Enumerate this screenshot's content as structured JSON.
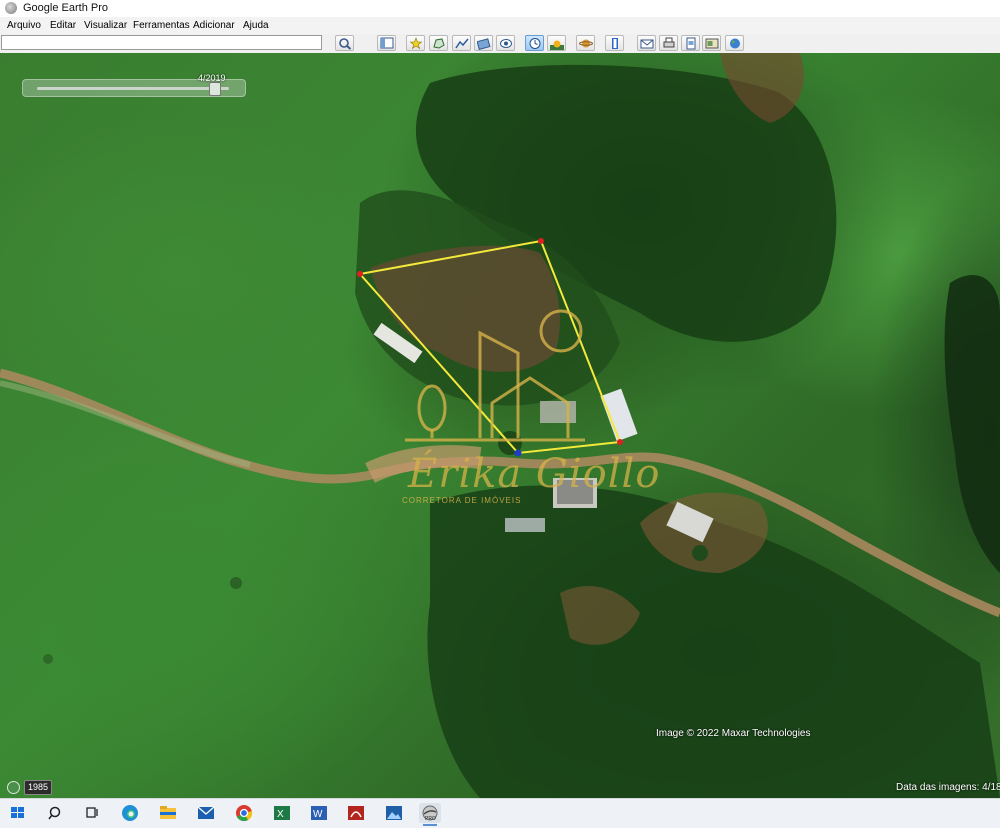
{
  "window": {
    "title": "Google Earth Pro"
  },
  "menu": {
    "arquivo": "Arquivo",
    "editar": "Editar",
    "visualizar": "Visualizar",
    "ferramentas": "Ferramentas",
    "adicionar": "Adicionar",
    "ajuda": "Ajuda"
  },
  "search": {
    "value": ""
  },
  "toolbar_icons": [
    "search-icon",
    "sidebar-icon",
    "placemark-icon",
    "polygon-icon",
    "path-icon",
    "image-overlay-icon",
    "record-tour-icon",
    "historical-imagery-icon",
    "sun-icon",
    "planets-icon",
    "ruler-icon",
    "email-icon",
    "print-icon",
    "save-image-icon",
    "maps-icon",
    "earth-icon"
  ],
  "map": {
    "time_slider_date": "4/2019",
    "imagery_credit": "Image © 2022 Maxar Technologies",
    "imagery_date_label": "Data das imagens: 4/18",
    "historical_year": "1985",
    "watermark_name": "Érika Giollo",
    "watermark_subtitle": "CORRETORA DE IMÓVEIS",
    "polygon_color": "#f3e93a"
  },
  "taskbar": {
    "apps": [
      "windows-start-icon",
      "search-icon",
      "task-view-icon",
      "edge-icon",
      "file-explorer-icon",
      "mail-icon",
      "chrome-icon",
      "excel-icon",
      "word-icon",
      "acrobat-icon",
      "photos-icon",
      "google-earth-icon"
    ]
  }
}
